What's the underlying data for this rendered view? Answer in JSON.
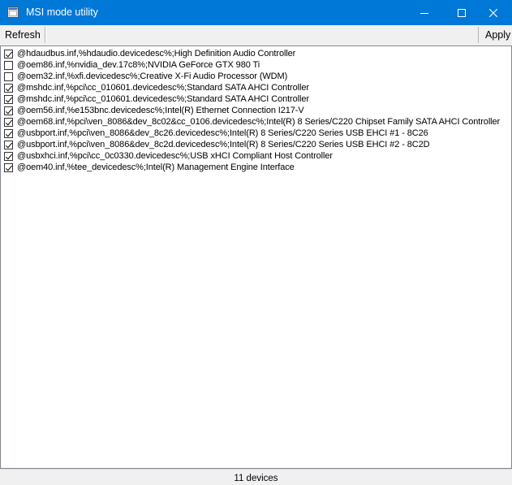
{
  "window": {
    "title": "MSI mode utility",
    "minimize": "—",
    "maximize": "☐",
    "close": "✕"
  },
  "toolbar": {
    "refresh_label": "Refresh",
    "apply_label": "Apply"
  },
  "devices": [
    {
      "text": "@hdaudbus.inf,%hdaudio.devicedesc%;High Definition Audio Controller",
      "checked": true
    },
    {
      "text": "@oem86.inf,%nvidia_dev.17c8%;NVIDIA GeForce GTX 980 Ti",
      "checked": false
    },
    {
      "text": "@oem32.inf,%xfi.devicedesc%;Creative X-Fi Audio Processor (WDM)",
      "checked": false
    },
    {
      "text": "@mshdc.inf,%pci\\cc_010601.devicedesc%;Standard SATA AHCI Controller",
      "checked": true
    },
    {
      "text": "@mshdc.inf,%pci\\cc_010601.devicedesc%;Standard SATA AHCI Controller",
      "checked": true
    },
    {
      "text": "@oem56.inf,%e153bnc.devicedesc%;Intel(R) Ethernet Connection I217-V",
      "checked": true
    },
    {
      "text": "@oem68.inf,%pci\\ven_8086&dev_8c02&cc_0106.devicedesc%;Intel(R) 8 Series/C220 Chipset Family SATA AHCI Controller",
      "checked": true
    },
    {
      "text": "@usbport.inf,%pci\\ven_8086&dev_8c26.devicedesc%;Intel(R) 8 Series/C220 Series USB EHCI #1 - 8C26",
      "checked": true
    },
    {
      "text": "@usbport.inf,%pci\\ven_8086&dev_8c2d.devicedesc%;Intel(R) 8 Series/C220 Series USB EHCI #2 - 8C2D",
      "checked": true
    },
    {
      "text": "@usbxhci.inf,%pci\\cc_0c0330.devicedesc%;USB xHCI Compliant Host Controller",
      "checked": true
    },
    {
      "text": "@oem40.inf,%tee_devicedesc%;Intel(R) Management Engine Interface",
      "checked": true
    }
  ],
  "status": {
    "text": "11 devices"
  },
  "colors": {
    "titlebar": "#0078d7",
    "background": "#f0f0f0",
    "list_background": "#ffffff"
  }
}
